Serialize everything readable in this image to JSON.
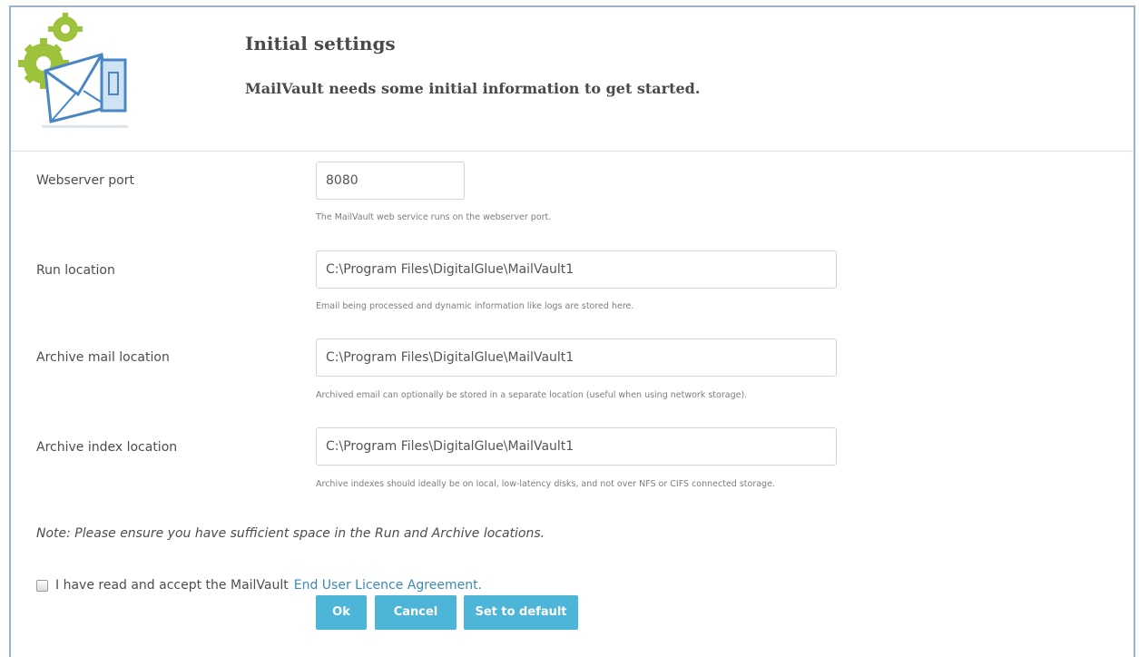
{
  "header": {
    "title": "Initial settings",
    "subtitle": "MailVault needs some initial information to get started."
  },
  "form": {
    "fields": [
      {
        "label": "Webserver port",
        "value": "8080",
        "help": "The MailVault web service runs on the webserver port."
      },
      {
        "label": "Run location",
        "value": "C:\\Program Files\\DigitalGlue\\MailVault1",
        "help": "Email being processed and dynamic information like logs are stored here."
      },
      {
        "label": "Archive mail location",
        "value": "C:\\Program Files\\DigitalGlue\\MailVault1",
        "help": "Archived email can optionally be stored in a separate location (useful when using network storage)."
      },
      {
        "label": "Archive index location",
        "value": "C:\\Program Files\\DigitalGlue\\MailVault1",
        "help": "Archive indexes should ideally be on local, low-latency disks, and not over NFS or CIFS connected storage."
      }
    ],
    "note": "Note: Please ensure you have sufficient space in the Run and Archive locations.",
    "agree_text": "I have read and accept the MailVault",
    "agree_link": "End User Licence Agreement."
  },
  "buttons": {
    "ok": "Ok",
    "cancel": "Cancel",
    "default": "Set to default"
  },
  "colors": {
    "accent": "#4db5d8",
    "link": "#3a8ab5"
  }
}
